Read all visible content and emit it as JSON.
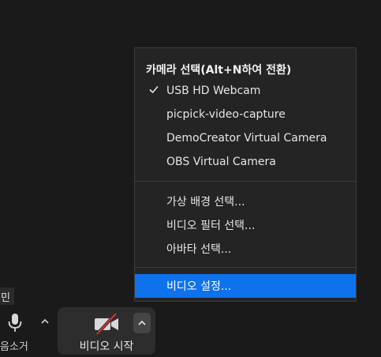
{
  "camera_menu": {
    "header": "카메라 선택(Alt+N하여 전환)",
    "cameras": [
      {
        "label": "USB HD Webcam",
        "selected": true
      },
      {
        "label": "picpick-video-capture",
        "selected": false
      },
      {
        "label": "DemoCreator Virtual Camera",
        "selected": false
      },
      {
        "label": "OBS Virtual Camera",
        "selected": false
      }
    ],
    "options": [
      {
        "label": "가상 배경 선택..."
      },
      {
        "label": "비디오 필터 선택..."
      },
      {
        "label": "아바타 선택..."
      }
    ],
    "settings_label": "비디오 설정...",
    "highlight_color": "#0e72ed"
  },
  "toolbar": {
    "name_tag": "민",
    "mic_label": "음소거",
    "video_label": "비디오 시작",
    "video_muted_color": "#e0312f"
  }
}
